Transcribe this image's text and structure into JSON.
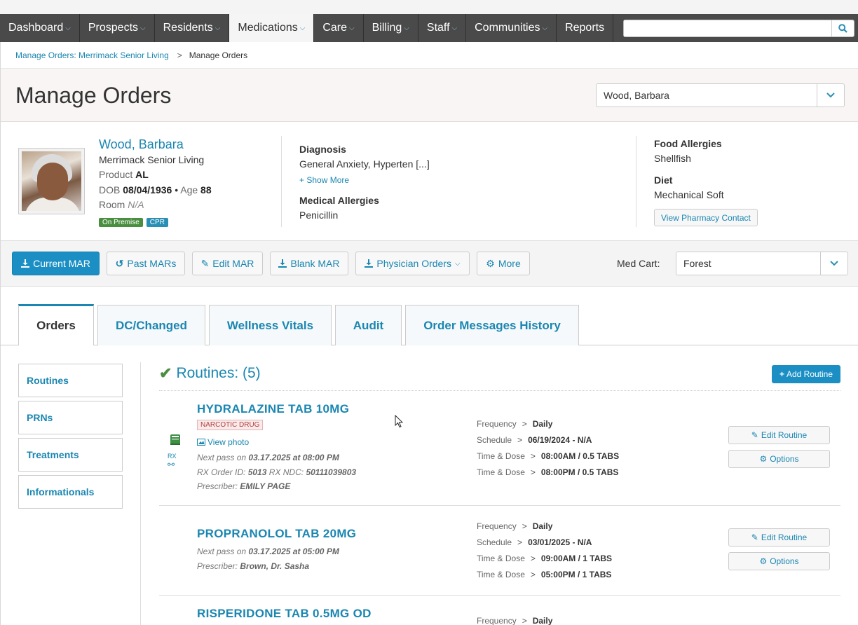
{
  "nav": {
    "items": [
      {
        "label": "Dashboard",
        "chevron": true
      },
      {
        "label": "Prospects",
        "chevron": true
      },
      {
        "label": "Residents",
        "chevron": true
      },
      {
        "label": "Medications",
        "chevron": true,
        "active": true
      },
      {
        "label": "Care",
        "chevron": true
      },
      {
        "label": "Billing",
        "chevron": true
      },
      {
        "label": "Staff",
        "chevron": true
      },
      {
        "label": "Communities",
        "chevron": true
      },
      {
        "label": "Reports",
        "chevron": false
      }
    ],
    "search_placeholder": "",
    "search_icon": "search-icon"
  },
  "breadcrumb": {
    "parent": "Manage Orders: Merrimack Senior Living",
    "separator": ">",
    "current": "Manage Orders"
  },
  "header": {
    "title": "Manage Orders",
    "resident_select": "Wood, Barbara"
  },
  "resident": {
    "name": "Wood, Barbara",
    "community": "Merrimack Senior Living",
    "product_label": "Product",
    "product": "AL",
    "dob_label": "DOB",
    "dob": "08/04/1936",
    "bullet": "•",
    "age_label": "Age",
    "age": "88",
    "room_label": "Room",
    "room": "N/A",
    "badges": [
      "On Premise",
      "CPR"
    ],
    "diagnosis_label": "Diagnosis",
    "diagnosis": "General Anxiety, Hyperten [...]",
    "show_more": "Show More",
    "medical_allergies_label": "Medical Allergies",
    "medical_allergies": "Penicillin",
    "food_allergies_label": "Food Allergies",
    "food_allergies": "Shellfish",
    "diet_label": "Diet",
    "diet": "Mechanical Soft",
    "pharmacy_button": "View Pharmacy Contact"
  },
  "actions": {
    "current_mar": "Current MAR",
    "past_mars": "Past MARs",
    "edit_mar": "Edit MAR",
    "blank_mar": "Blank MAR",
    "physician_orders": "Physician Orders",
    "more": "More",
    "med_cart_label": "Med Cart:",
    "med_cart_value": "Forest"
  },
  "tabs": [
    {
      "label": "Orders",
      "active": true
    },
    {
      "label": "DC/Changed"
    },
    {
      "label": "Wellness Vitals"
    },
    {
      "label": "Audit"
    },
    {
      "label": "Order Messages History"
    }
  ],
  "subnav": [
    "Routines",
    "PRNs",
    "Treatments",
    "Informationals"
  ],
  "routines": {
    "heading": "Routines: (5)",
    "add_button": "Add Routine",
    "edit_button": "Edit Routine",
    "options_button": "Options",
    "items": [
      {
        "name": "HYDRALAZINE TAB 10MG",
        "badge": "NARCOTIC DRUG",
        "view_photo": "View photo",
        "next_pass_label": "Next pass on",
        "next_pass": "03.17.2025 at 08:00 PM",
        "rx_order_label": "RX Order ID:",
        "rx_order_id": "5013",
        "rx_ndc_label": "RX NDC:",
        "rx_ndc": "50111039803",
        "prescriber_label": "Prescriber:",
        "prescriber": "EMILY PAGE",
        "frequency": "Daily",
        "schedule": "06/19/2024 - N/A",
        "times": [
          "08:00AM / 0.5 TABS",
          "08:00PM / 0.5 TABS"
        ]
      },
      {
        "name": "PROPRANOLOL TAB 20MG",
        "next_pass_label": "Next pass on",
        "next_pass": "03.17.2025 at 05:00 PM",
        "prescriber_label": "Prescriber:",
        "prescriber": "Brown, Dr. Sasha",
        "frequency": "Daily",
        "schedule": "03/01/2025 - N/A",
        "times": [
          "09:00AM / 1 TABS",
          "05:00PM / 1 TABS"
        ]
      },
      {
        "name": "RISPERIDONE TAB 0.5MG OD",
        "frequency": "Daily"
      }
    ],
    "labels": {
      "frequency": "Frequency",
      "schedule": "Schedule",
      "time_dose": "Time & Dose",
      "arrow": ">"
    }
  },
  "colors": {
    "accent": "#1a86b1",
    "nav_bg": "#4a4a4a",
    "primary_button": "#1b8fc4",
    "badge_green": "#4a8f3f",
    "check_green": "#4a8f3f"
  }
}
